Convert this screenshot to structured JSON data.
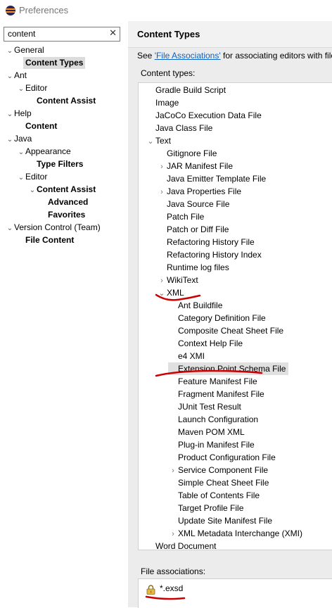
{
  "window": {
    "title": "Preferences"
  },
  "filter": {
    "value": "content"
  },
  "nav": [
    {
      "label": "General",
      "depth": 0,
      "expander": "v",
      "bold": false,
      "selected": false
    },
    {
      "label": "Content Types",
      "depth": 1,
      "expander": "",
      "bold": true,
      "selected": true
    },
    {
      "label": "Ant",
      "depth": 0,
      "expander": "v",
      "bold": false,
      "selected": false
    },
    {
      "label": "Editor",
      "depth": 1,
      "expander": "v",
      "bold": false,
      "selected": false
    },
    {
      "label": "Content Assist",
      "depth": 2,
      "expander": "",
      "bold": true,
      "selected": false
    },
    {
      "label": "Help",
      "depth": 0,
      "expander": "v",
      "bold": false,
      "selected": false
    },
    {
      "label": "Content",
      "depth": 1,
      "expander": "",
      "bold": true,
      "selected": false
    },
    {
      "label": "Java",
      "depth": 0,
      "expander": "v",
      "bold": false,
      "selected": false
    },
    {
      "label": "Appearance",
      "depth": 1,
      "expander": "v",
      "bold": false,
      "selected": false
    },
    {
      "label": "Type Filters",
      "depth": 2,
      "expander": "",
      "bold": true,
      "selected": false
    },
    {
      "label": "Editor",
      "depth": 1,
      "expander": "v",
      "bold": false,
      "selected": false
    },
    {
      "label": "Content Assist",
      "depth": 2,
      "expander": "v",
      "bold": true,
      "selected": false
    },
    {
      "label": "Advanced",
      "depth": 3,
      "expander": "",
      "bold": true,
      "selected": false
    },
    {
      "label": "Favorites",
      "depth": 3,
      "expander": "",
      "bold": true,
      "selected": false
    },
    {
      "label": "Version Control (Team)",
      "depth": 0,
      "expander": "v",
      "bold": false,
      "selected": false
    },
    {
      "label": "File Content",
      "depth": 1,
      "expander": "",
      "bold": true,
      "selected": false
    }
  ],
  "page": {
    "title": "Content Types",
    "see_prefix": "See ",
    "see_link": "'File Associations'",
    "see_suffix": " for associating editors with file",
    "content_types_label": "Content types:",
    "file_assoc_label": "File associations:"
  },
  "content_types": [
    {
      "label": "Gradle Build Script",
      "depth": 0,
      "expander": ""
    },
    {
      "label": "Image",
      "depth": 0,
      "expander": ""
    },
    {
      "label": "JaCoCo Execution Data File",
      "depth": 0,
      "expander": ""
    },
    {
      "label": "Java Class File",
      "depth": 0,
      "expander": ""
    },
    {
      "label": "Text",
      "depth": 0,
      "expander": "v"
    },
    {
      "label": "Gitignore File",
      "depth": 1,
      "expander": ""
    },
    {
      "label": "JAR Manifest File",
      "depth": 1,
      "expander": ">"
    },
    {
      "label": "Java Emitter Template File",
      "depth": 1,
      "expander": ""
    },
    {
      "label": "Java Properties File",
      "depth": 1,
      "expander": ">"
    },
    {
      "label": "Java Source File",
      "depth": 1,
      "expander": ""
    },
    {
      "label": "Patch File",
      "depth": 1,
      "expander": ""
    },
    {
      "label": "Patch or Diff File",
      "depth": 1,
      "expander": ""
    },
    {
      "label": "Refactoring History File",
      "depth": 1,
      "expander": ""
    },
    {
      "label": "Refactoring History Index",
      "depth": 1,
      "expander": ""
    },
    {
      "label": "Runtime log files",
      "depth": 1,
      "expander": ""
    },
    {
      "label": "WikiText",
      "depth": 1,
      "expander": ">"
    },
    {
      "label": "XML",
      "depth": 1,
      "expander": "v"
    },
    {
      "label": "Ant Buildfile",
      "depth": 2,
      "expander": ""
    },
    {
      "label": "Category Definition File",
      "depth": 2,
      "expander": ""
    },
    {
      "label": "Composite Cheat Sheet File",
      "depth": 2,
      "expander": ""
    },
    {
      "label": "Context Help File",
      "depth": 2,
      "expander": ""
    },
    {
      "label": "e4 XMI",
      "depth": 2,
      "expander": ""
    },
    {
      "label": "Extension Point Schema File",
      "depth": 2,
      "expander": "",
      "highlight": true
    },
    {
      "label": "Feature Manifest File",
      "depth": 2,
      "expander": ""
    },
    {
      "label": "Fragment Manifest File",
      "depth": 2,
      "expander": ""
    },
    {
      "label": "JUnit Test Result",
      "depth": 2,
      "expander": ""
    },
    {
      "label": "Launch Configuration",
      "depth": 2,
      "expander": ""
    },
    {
      "label": "Maven POM XML",
      "depth": 2,
      "expander": ""
    },
    {
      "label": "Plug-in Manifest File",
      "depth": 2,
      "expander": ""
    },
    {
      "label": "Product Configuration File",
      "depth": 2,
      "expander": ""
    },
    {
      "label": "Service Component File",
      "depth": 2,
      "expander": ">"
    },
    {
      "label": "Simple Cheat Sheet File",
      "depth": 2,
      "expander": ""
    },
    {
      "label": "Table of Contents File",
      "depth": 2,
      "expander": ""
    },
    {
      "label": "Target Profile File",
      "depth": 2,
      "expander": ""
    },
    {
      "label": "Update Site Manifest File",
      "depth": 2,
      "expander": ""
    },
    {
      "label": "XML Metadata Interchange (XMI)",
      "depth": 2,
      "expander": ">"
    },
    {
      "label": "Word Document",
      "depth": 0,
      "expander": ""
    }
  ],
  "file_associations": [
    {
      "label": "*.exsd",
      "icon": "lock-icon"
    }
  ],
  "colors": {
    "annotation": "#cc0000",
    "link": "#0b63c5",
    "selection": "#dcdcdc"
  }
}
